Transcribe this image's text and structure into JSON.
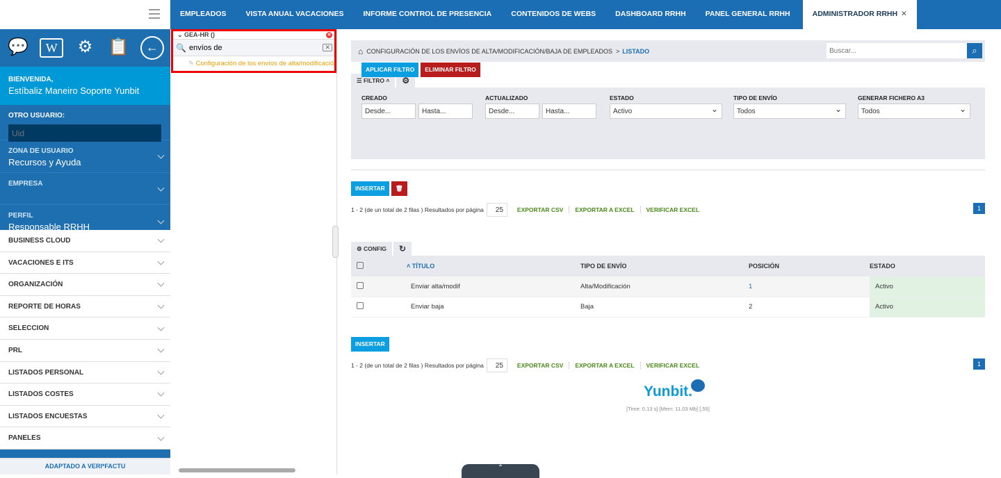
{
  "tabs": [
    "EMPLEADOS",
    "VISTA ANUAL VACACIONES",
    "INFORME CONTROL DE PRESENCIA",
    "CONTENIDOS DE WEBS",
    "DASHBOARD RRHH",
    "PANEL GENERAL RRHH",
    "ADMINISTRADOR RRHH"
  ],
  "sidebar": {
    "welcome_label": "BIENVENIDA,",
    "user": "Estíbaliz Maneiro Soporte Yunbit",
    "other_user_label": "OTRO USUARIO:",
    "uid_placeholder": "Uid",
    "zona_label": "ZONA DE USUARIO",
    "zona_value": "Recursos y Ayuda",
    "empresa_label": "EMPRESA",
    "perfil_label": "PERFIL",
    "perfil_value": "Responsable RRHH",
    "menu": [
      "BUSINESS CLOUD",
      "VACACIONES E ITS",
      "ORGANIZACIÓN",
      "REPORTE DE HORAS",
      "SELECCION",
      "PRL",
      "LISTADOS PERSONAL",
      "LISTADOS COSTES",
      "LISTADOS ENCUESTAS",
      "PANELES"
    ],
    "footer": "ADAPTADO A VERI*FACTU"
  },
  "panel": {
    "group": "GEA-HR ()",
    "search": "envíos de",
    "result": "Configuración de los envíos de alta/modificación/baja de empleados"
  },
  "breadcrumb": {
    "path": "CONFIGURACIÓN DE LOS ENVÍOS DE ALTA/MODIFICACIÓN/BAJA DE EMPLEADOS",
    "sep": ">",
    "current": "LISTADO",
    "search_placeholder": "Buscar..."
  },
  "filter": {
    "tab": "FILTRO",
    "creado": "CREADO",
    "actualizado": "ACTUALIZADO",
    "desde": "Desde...",
    "hasta": "Hasta...",
    "estado": "ESTADO",
    "estado_val": "Activo",
    "tipo": "TIPO DE ENVÍO",
    "tipo_val": "Todos",
    "a3": "GENERAR FICHERO A3",
    "a3_val": "Todos",
    "apply": "APLICAR FILTRO",
    "remove": "ELIMINAR FILTRO"
  },
  "list": {
    "insert": "INSERTAR",
    "info": "1 - 2 (de un total de 2 filas )  Resultados por página",
    "per_page": "25",
    "csv": "EXPORTAR CSV",
    "excel": "EXPORTAR A EXCEL",
    "verify": "VERIFICAR EXCEL",
    "page": "1",
    "config": "CONFIG",
    "headers": [
      "TÍTULO",
      "TIPO DE ENVÍO",
      "POSICIÓN",
      "ESTADO"
    ],
    "rows": [
      [
        "Enviar alta/modif",
        "Alta/Modificación",
        "1",
        "Activo"
      ],
      [
        "Enviar baja",
        "Baja",
        "2",
        "Activo"
      ]
    ]
  },
  "footer": {
    "logo": "Yunbit.",
    "stats": "[Time: 0,13 s] [Mem: 11,03 Mb] [,55]",
    "bottom_tab": "⌃"
  }
}
